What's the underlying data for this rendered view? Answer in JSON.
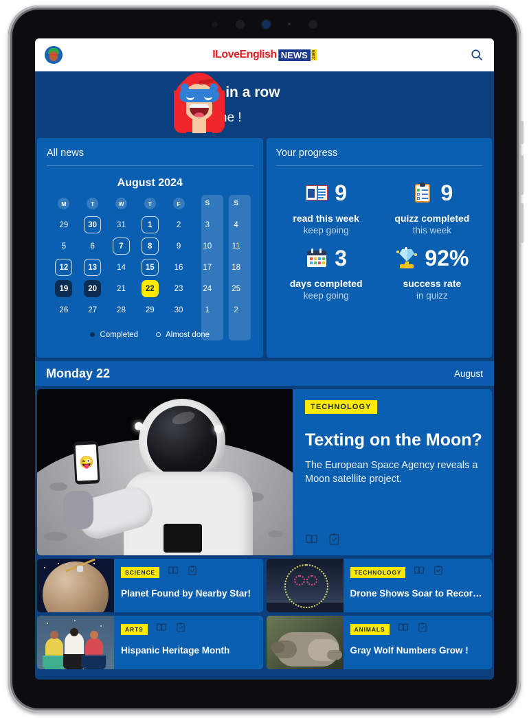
{
  "header": {
    "avatar_name": "user-avatar",
    "logo": {
      "part1": "ILoveEnglish",
      "part2": "NEWS",
      "part3": ".com"
    },
    "search_label": "Search"
  },
  "streak": {
    "title": "3 days in a row",
    "subtitle": "Well done !"
  },
  "news_panel": {
    "title": "All news",
    "calendar": {
      "month_label": "August 2024",
      "weekdays": [
        "M",
        "T",
        "W",
        "T",
        "F",
        "S",
        "S"
      ],
      "weeks": [
        [
          {
            "n": "29",
            "state": "out"
          },
          {
            "n": "30",
            "state": "almost"
          },
          {
            "n": "31",
            "state": "out"
          },
          {
            "n": "1",
            "state": "almost"
          },
          {
            "n": "2",
            "state": "normal"
          },
          {
            "n": "3",
            "state": "normal"
          },
          {
            "n": "4",
            "state": "normal"
          }
        ],
        [
          {
            "n": "5",
            "state": "normal"
          },
          {
            "n": "6",
            "state": "normal"
          },
          {
            "n": "7",
            "state": "almost"
          },
          {
            "n": "8",
            "state": "almost"
          },
          {
            "n": "9",
            "state": "normal"
          },
          {
            "n": "10",
            "state": "normal"
          },
          {
            "n": "11",
            "state": "normal"
          }
        ],
        [
          {
            "n": "12",
            "state": "almost"
          },
          {
            "n": "13",
            "state": "almost"
          },
          {
            "n": "14",
            "state": "normal"
          },
          {
            "n": "15",
            "state": "almost"
          },
          {
            "n": "16",
            "state": "normal"
          },
          {
            "n": "17",
            "state": "normal"
          },
          {
            "n": "18",
            "state": "normal"
          }
        ],
        [
          {
            "n": "19",
            "state": "done"
          },
          {
            "n": "20",
            "state": "done"
          },
          {
            "n": "21",
            "state": "normal"
          },
          {
            "n": "22",
            "state": "today"
          },
          {
            "n": "23",
            "state": "normal"
          },
          {
            "n": "24",
            "state": "normal"
          },
          {
            "n": "25",
            "state": "normal"
          }
        ],
        [
          {
            "n": "26",
            "state": "normal"
          },
          {
            "n": "27",
            "state": "normal"
          },
          {
            "n": "28",
            "state": "normal"
          },
          {
            "n": "29",
            "state": "normal"
          },
          {
            "n": "30",
            "state": "normal"
          },
          {
            "n": "1",
            "state": "out"
          },
          {
            "n": "2",
            "state": "out"
          }
        ]
      ],
      "legend": [
        {
          "label": "Completed",
          "marker": "filled"
        },
        {
          "label": "Almost done",
          "marker": "outline"
        }
      ]
    }
  },
  "progress_panel": {
    "title": "Your progress",
    "stats": [
      {
        "icon": "newspaper-icon",
        "value": "9",
        "line1": "read this week",
        "line2": "keep going"
      },
      {
        "icon": "clipboard-icon",
        "value": "9",
        "line1": "quizz completed",
        "line2": "this week"
      },
      {
        "icon": "calendar-icon",
        "value": "3",
        "line1": "days completed",
        "line2": "keep going"
      },
      {
        "icon": "trophy-gem-icon",
        "value": "92%",
        "line1": "success rate",
        "line2": "in quizz"
      }
    ]
  },
  "date_bar": {
    "day": "Monday 22",
    "month": "August"
  },
  "featured": {
    "tag": "TECHNOLOGY",
    "headline": "Texting on the Moon?",
    "summary": "The European Space Agency reveals a Moon satellite project.",
    "image_alt": "astronaut-on-moon-holding-phone",
    "phone_emoji": "😜",
    "actions": [
      "read-icon",
      "quiz-icon"
    ]
  },
  "cards": [
    {
      "tag": "SCIENCE",
      "title": "Planet Found by Nearby Star!",
      "art": "planet"
    },
    {
      "tag": "TECHNOLOGY",
      "title": "Drone Shows Soar to Records!",
      "art": "drone"
    },
    {
      "tag": "ARTS",
      "title": "Hispanic Heritage Month",
      "art": "festival"
    },
    {
      "tag": "ANIMALS",
      "title": "Gray Wolf Numbers Grow !",
      "art": "wolf"
    }
  ],
  "colors": {
    "navy": "#0b3f7d",
    "panel_blue": "#0a5fb0",
    "date_blue": "#0b5cae",
    "accent_yellow": "#ffe900",
    "completed_navy": "#0c2d52",
    "logo_red": "#e0211e"
  }
}
